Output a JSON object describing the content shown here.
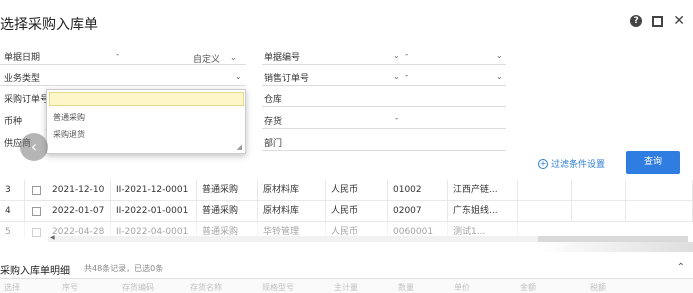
{
  "window": {
    "title": "选择采购入库单",
    "help_icon": "question-circle",
    "maximize_icon": "maximize",
    "close_icon": "close"
  },
  "filters": {
    "doc_date": {
      "label": "单据日期",
      "separator": "-",
      "range_label": "自定义"
    },
    "doc_no": {
      "label": "单据编号",
      "separator": "-"
    },
    "business_type": {
      "label": "业务类型"
    },
    "sales_order_no": {
      "label": "销售订单号",
      "separator": "-"
    },
    "purchase_order_no": {
      "label": "采购订单号"
    },
    "warehouse": {
      "label": "仓库"
    },
    "currency": {
      "label": "币种"
    },
    "inventory": {
      "label": "存货",
      "separator": "-"
    },
    "supplier": {
      "label": "供应商"
    },
    "department": {
      "label": "部门"
    }
  },
  "dropdown": {
    "input_value": "",
    "options": [
      "普通采购",
      "采购退货"
    ]
  },
  "actions": {
    "filter_settings": "过滤条件设置",
    "query": "查询"
  },
  "table": {
    "rows": [
      {
        "index": "3",
        "date": "2021-12-10",
        "doc_no": "II-2021-12-0001",
        "type": "普通采购",
        "warehouse": "原材料库",
        "currency": "人民币",
        "code": "01002",
        "supplier": "江西产链..."
      },
      {
        "index": "4",
        "date": "2022-01-07",
        "doc_no": "II-2022-01-0001",
        "type": "普通采购",
        "warehouse": "原材料库",
        "currency": "人民币",
        "code": "02007",
        "supplier": "广东姐线..."
      },
      {
        "index": "5",
        "date": "2022-04-28",
        "doc_no": "II-2022-04-0001",
        "type": "普通采购",
        "warehouse": "华铃管理",
        "currency": "人民币",
        "code": "0060001",
        "supplier": "测试1..."
      }
    ]
  },
  "detail": {
    "title": "采购入库单明细",
    "count_text": "共48条记录，已选0条",
    "columns": [
      "选择",
      "序号",
      "存货编码",
      "存货名称",
      "规格型号",
      "主计量",
      "数量",
      "单价",
      "金额",
      "税额"
    ]
  }
}
